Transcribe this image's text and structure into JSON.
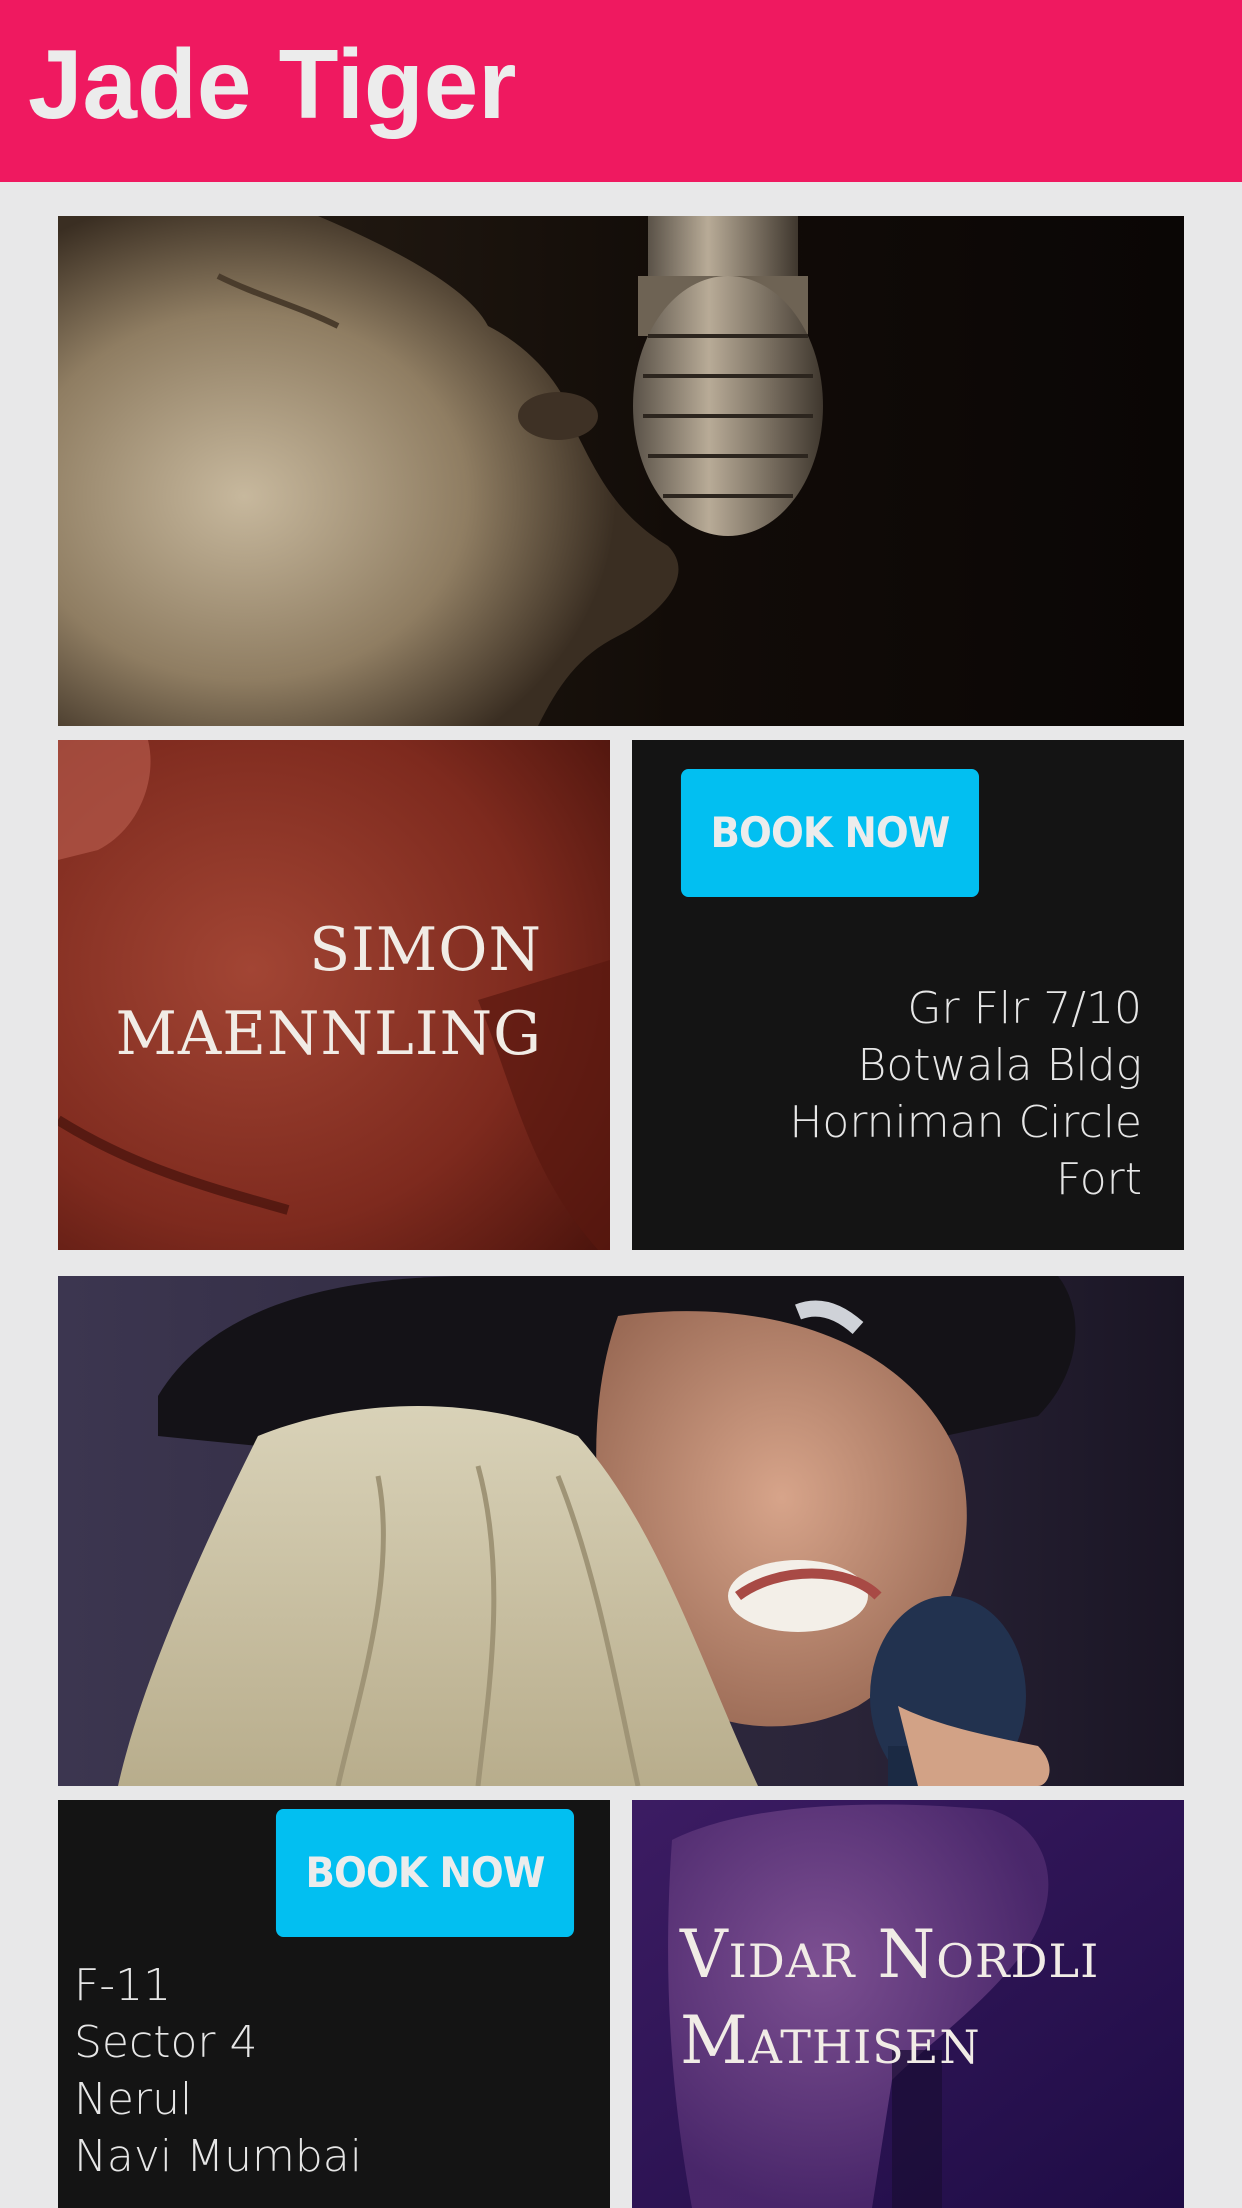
{
  "header": {
    "title": "Jade Tiger",
    "background_color": "#ef1960",
    "title_color": "#ececec"
  },
  "theme": {
    "page_background": "#e8e8e9",
    "venue_tile_background": "#141414",
    "button_color": "#02bff1",
    "button_text_color": "#ececec"
  },
  "events": [
    {
      "hero_image": "male-singer-with-vintage-microphone-photo",
      "artist": {
        "name_lines": [
          "SIMON",
          "MAENNLING"
        ],
        "background_image": "red-tinted-face-closeup-photo"
      },
      "booking": {
        "button_label": "BOOK NOW",
        "address_lines": [
          "Gr Flr 7/10",
          "Botwala Bldg",
          "Horniman Circle",
          "Fort"
        ]
      }
    },
    {
      "hero_image": "blonde-female-singer-with-microphone-photo",
      "artist": {
        "name_lines": [
          "Vidar Nordli",
          "Mathisen"
        ],
        "background_image": "purple-tinted-hand-with-microphone-photo"
      },
      "booking": {
        "button_label": "BOOK NOW",
        "address_lines": [
          "F-11",
          "Sector 4",
          "Nerul",
          "Navi Mumbai"
        ]
      }
    }
  ]
}
